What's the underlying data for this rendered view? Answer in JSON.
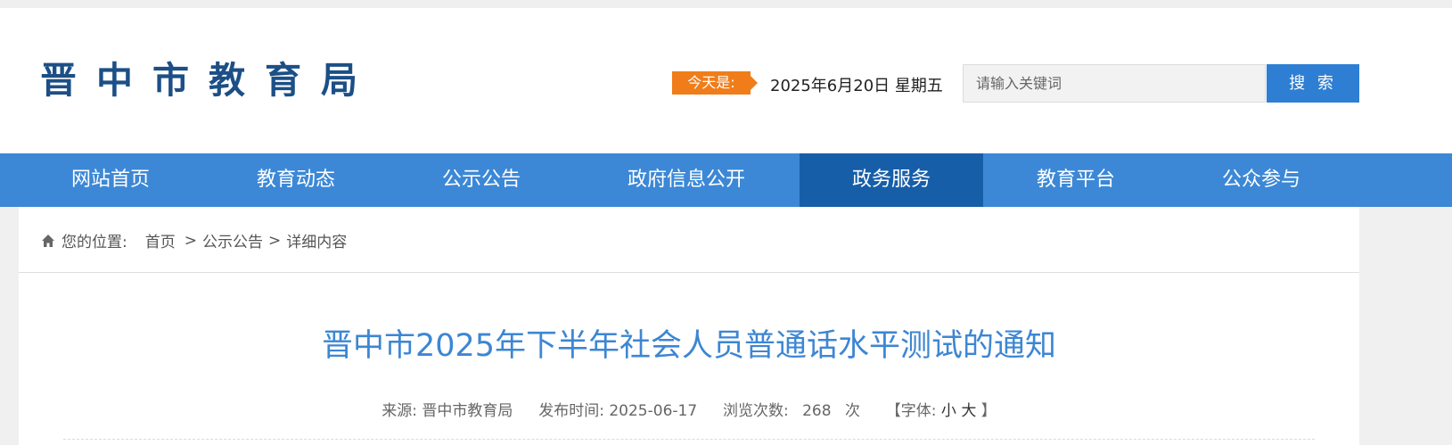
{
  "header": {
    "site_title": "晋中市教育局",
    "today_label": "今天是:",
    "date": "2025年6月20日 星期五",
    "search": {
      "placeholder": "请输入关键词",
      "button_label": "搜 索"
    }
  },
  "nav": {
    "items": [
      {
        "label": "网站首页"
      },
      {
        "label": "教育动态"
      },
      {
        "label": "公示公告"
      },
      {
        "label": "政府信息公开"
      },
      {
        "label": "政务服务",
        "active": true
      },
      {
        "label": "教育平台"
      },
      {
        "label": "公众参与"
      }
    ]
  },
  "breadcrumb": {
    "icon": "home-icon",
    "prefix": "您的位置:",
    "items": [
      "首页",
      "公示公告",
      "详细内容"
    ],
    "separator": ">"
  },
  "article": {
    "title": "晋中市2025年下半年社会人员普通话水平测试的通知",
    "source_label": "来源:",
    "source": "晋中市教育局",
    "published_label": "发布时间:",
    "published": "2025-06-17",
    "views_label": "浏览次数:",
    "views": "268",
    "views_unit": "次",
    "font_open": "【字体:",
    "font_small": "小",
    "font_large": "大",
    "font_close": "】"
  },
  "colors": {
    "nav_bg": "#3c88d6",
    "nav_active": "#175ea8",
    "accent_orange": "#f07d1a",
    "title_blue": "#3d86d3",
    "logo_blue": "#1c4f86"
  }
}
